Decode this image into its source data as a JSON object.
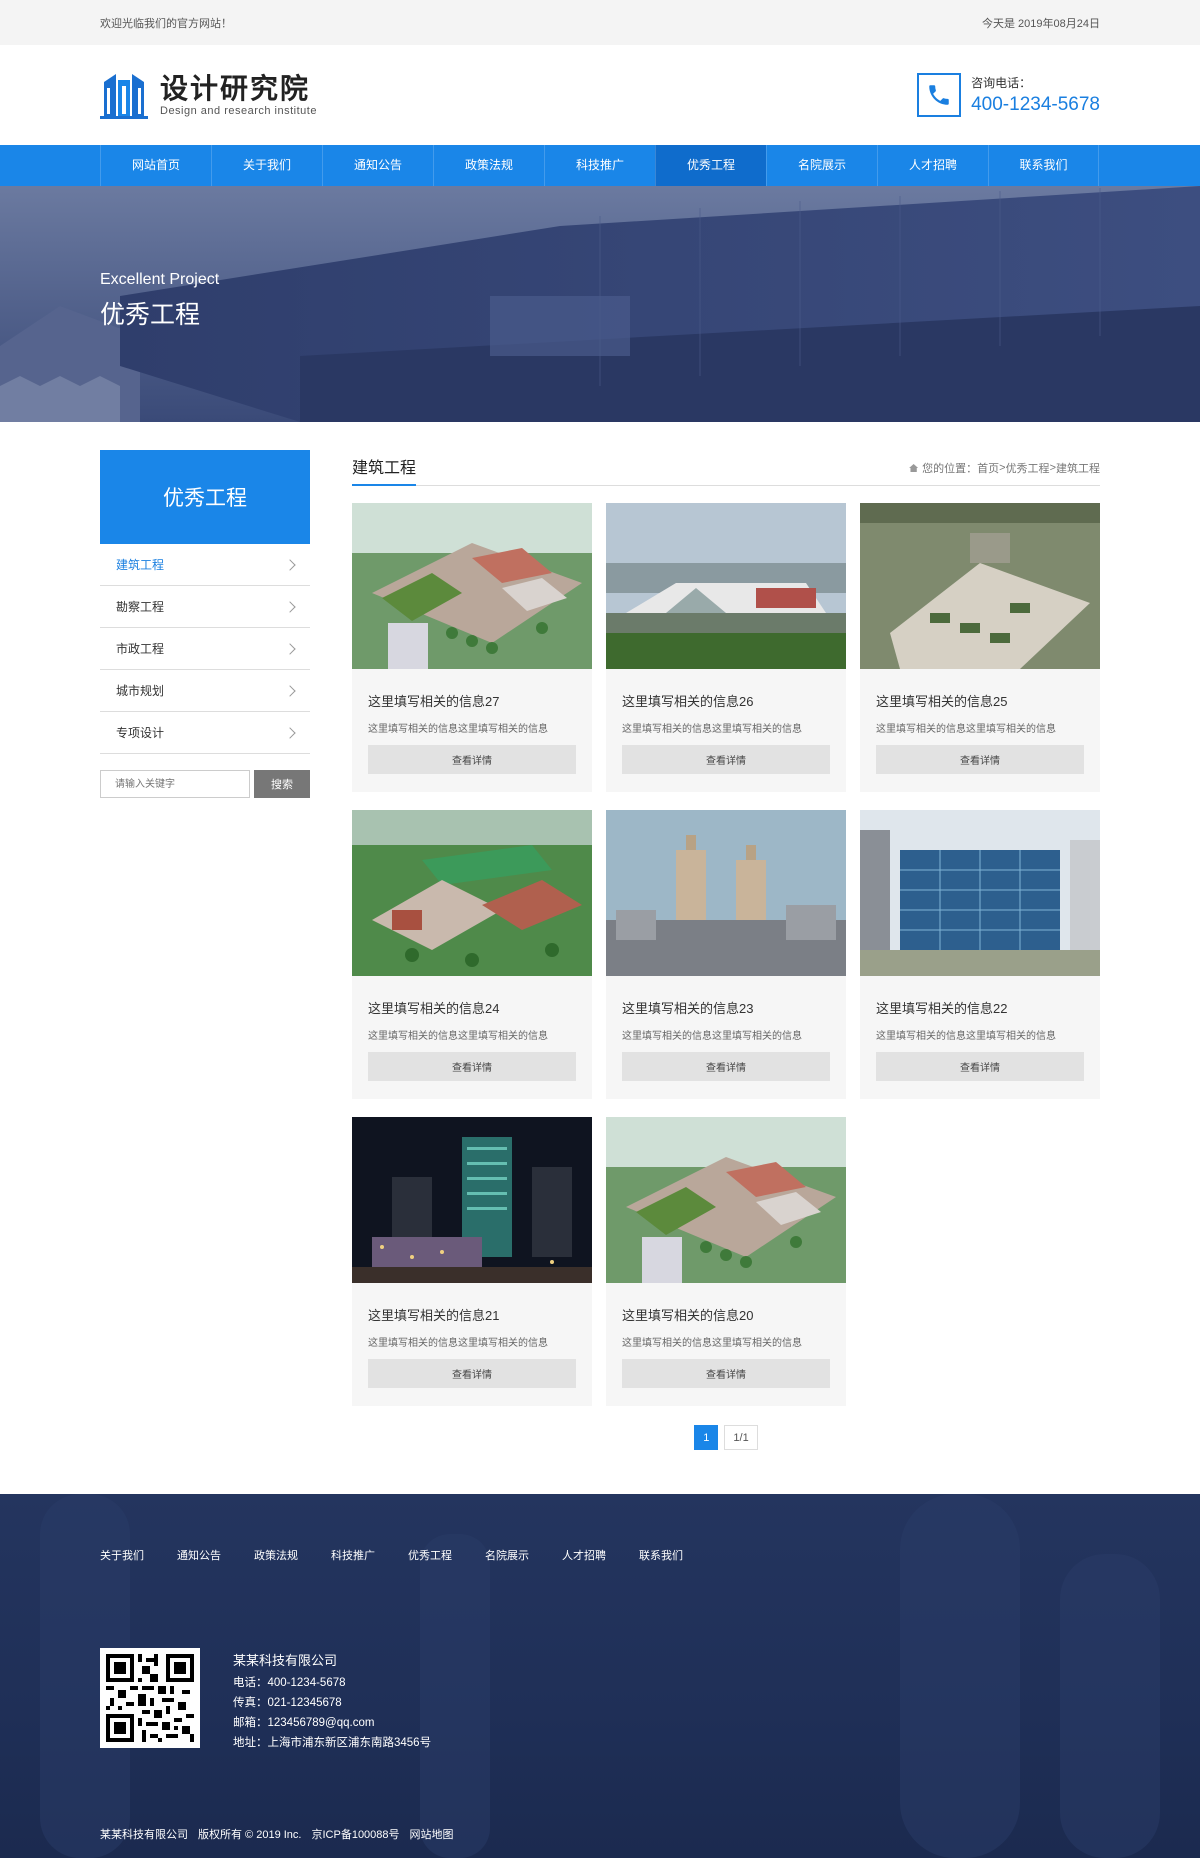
{
  "topbar": {
    "welcome": "欢迎光临我们的官方网站！",
    "date": "今天是 2019年08月24日"
  },
  "header": {
    "logo_cn": "设计研究院",
    "logo_en": "Design and research institute",
    "phone_label": "咨询电话：",
    "phone_number": "400-1234-5678"
  },
  "nav": [
    "网站首页",
    "关于我们",
    "通知公告",
    "政策法规",
    "科技推广",
    "优秀工程",
    "名院展示",
    "人才招聘",
    "联系我们"
  ],
  "nav_active_index": 5,
  "banner": {
    "en": "Excellent Project",
    "cn": "优秀工程"
  },
  "sidebar": {
    "title": "优秀工程",
    "items": [
      "建筑工程",
      "勘察工程",
      "市政工程",
      "城市规划",
      "专项设计"
    ],
    "active_index": 0,
    "search_placeholder": "请输入关键字",
    "search_button": "搜索"
  },
  "content": {
    "title": "建筑工程",
    "breadcrumb": {
      "prefix": "您的位置：",
      "home": "首页",
      "sep1": " > ",
      "section": "优秀工程",
      "sep2": " > ",
      "current": "建筑工程"
    },
    "cards": [
      {
        "title": "这里填写相关的信息27",
        "desc": "这里填写相关的信息这里填写相关的信息",
        "button": "查看详情",
        "image": "campus-aerial"
      },
      {
        "title": "这里填写相关的信息26",
        "desc": "这里填写相关的信息这里填写相关的信息",
        "button": "查看详情",
        "image": "waterfront-hall"
      },
      {
        "title": "这里填写相关的信息25",
        "desc": "这里填写相关的信息这里填写相关的信息",
        "button": "查看详情",
        "image": "plaza-aerial"
      },
      {
        "title": "这里填写相关的信息24",
        "desc": "这里填写相关的信息这里填写相关的信息",
        "button": "查看详情",
        "image": "school-aerial"
      },
      {
        "title": "这里填写相关的信息23",
        "desc": "这里填写相关的信息这里填写相关的信息",
        "button": "查看详情",
        "image": "twin-towers"
      },
      {
        "title": "这里填写相关的信息22",
        "desc": "这里填写相关的信息这里填写相关的信息",
        "button": "查看详情",
        "image": "glass-office"
      },
      {
        "title": "这里填写相关的信息21",
        "desc": "这里填写相关的信息这里填写相关的信息",
        "button": "查看详情",
        "image": "night-city"
      },
      {
        "title": "这里填写相关的信息20",
        "desc": "这里填写相关的信息这里填写相关的信息",
        "button": "查看详情",
        "image": "campus-aerial"
      }
    ],
    "pager": {
      "current": "1",
      "total": "1/1"
    }
  },
  "footer": {
    "nav": [
      "关于我们",
      "通知公告",
      "政策法规",
      "科技推广",
      "优秀工程",
      "名院展示",
      "人才招聘",
      "联系我们"
    ],
    "company": "某某科技有限公司",
    "phone": "电话：400-1234-5678",
    "fax": "传真：021-12345678",
    "email": "邮箱：123456789@qq.com",
    "address": "地址：上海市浦东新区浦东南路3456号",
    "copyright": [
      "某某科技有限公司",
      "版权所有 © 2019 Inc.",
      "京ICP备100088号",
      "网站地图"
    ]
  },
  "colors": {
    "primary": "#1a86e8",
    "footer_bg": "#22335c"
  }
}
